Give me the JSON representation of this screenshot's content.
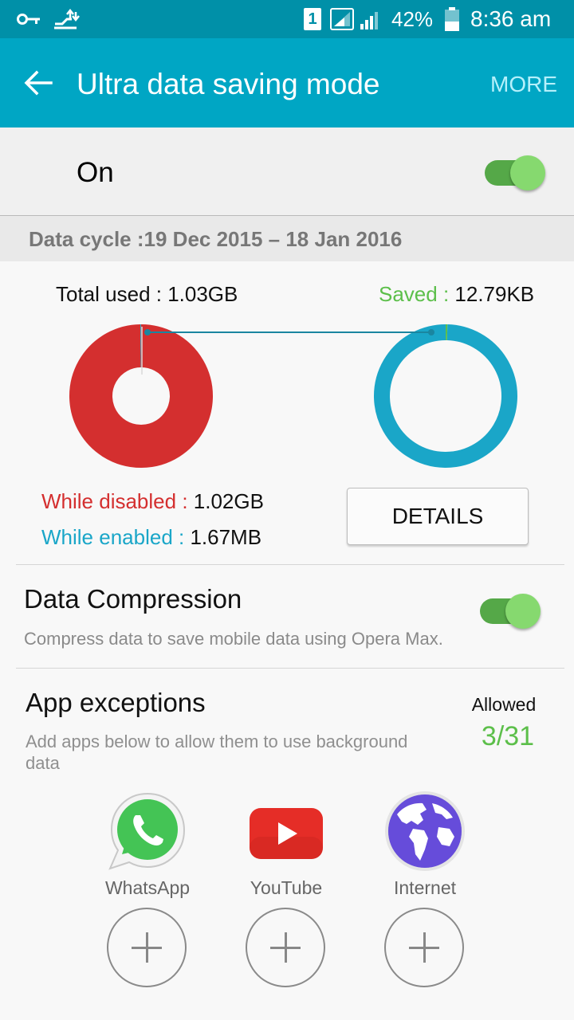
{
  "status_bar": {
    "battery": "42%",
    "time": "8:36 am",
    "sim_badge": "1",
    "icons": [
      "key-icon",
      "data-transfer-icon",
      "sim-icon",
      "signal-icon",
      "signal-icon",
      "battery-icon"
    ]
  },
  "toolbar": {
    "title": "Ultra data saving mode",
    "more_label": "MORE",
    "color": "#00a6c4"
  },
  "master_switch": {
    "label": "On",
    "state": "on"
  },
  "data_cycle": "Data cycle :19 Dec 2015 – 18 Jan 2016",
  "usage": {
    "total_used_label": "Total used : ",
    "total_used_value": "1.03GB",
    "saved_label": "Saved : ",
    "saved_value": "12.79KB",
    "disabled_label": "While disabled : ",
    "disabled_value": "1.02GB",
    "enabled_label": "While enabled : ",
    "enabled_value": "1.67MB",
    "details_label": "DETAILS",
    "colors": {
      "disabled": "#d42f2f",
      "enabled": "#1aa6c8",
      "saved": "#5cbf4a"
    }
  },
  "chart_data": [
    {
      "type": "pie",
      "slices": [
        {
          "label": "While disabled",
          "value": 1.02
        },
        {
          "label": "While enabled",
          "value": 0.00167
        }
      ]
    },
    {
      "type": "pie",
      "slices": [
        {
          "label": "Saved",
          "value": 1.28e-05
        },
        {
          "label": "Used",
          "value": 1.03
        }
      ]
    }
  ],
  "compression": {
    "title": "Data Compression",
    "subtitle": "Compress data to save mobile data using Opera Max.",
    "state": "on"
  },
  "exceptions": {
    "title": "App exceptions",
    "subtitle": "Add apps below to allow them to use background data",
    "allowed_label": "Allowed",
    "allowed_value": "3/31"
  },
  "apps": [
    {
      "name": "WhatsApp",
      "icon": "whatsapp-icon"
    },
    {
      "name": "YouTube",
      "icon": "youtube-icon"
    },
    {
      "name": "Internet",
      "icon": "internet-globe-icon"
    }
  ]
}
